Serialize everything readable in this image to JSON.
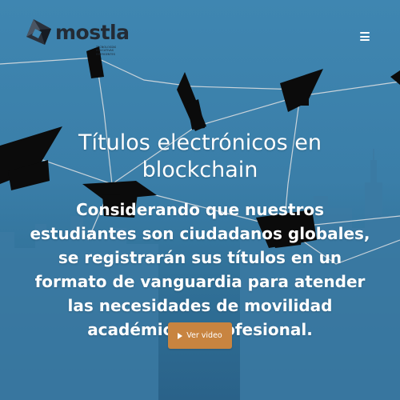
{
  "header": {
    "brand": "mostla",
    "tagline": "TECNOLOGÍAS EDUCATIVAS EMERGENTES",
    "logo_icon": "mostla-logo-icon",
    "menu_icon": "hamburger-menu-icon"
  },
  "hero": {
    "title": "Títulos electrónicos en blockchain",
    "subtitle": "Considerando que nuestros estudiantes son ciudadanos globales, se registrarán sus títulos en un formato de vanguardia para atender las necesidades de movilidad académica y profesional.",
    "cta_label": "Ver video",
    "cta_icon": "play-icon"
  },
  "colors": {
    "background_top": "#3f86b1",
    "background_bottom": "#2a6289",
    "accent": "#c88440",
    "text": "#ffffff",
    "logo_dark": "#232b35"
  }
}
